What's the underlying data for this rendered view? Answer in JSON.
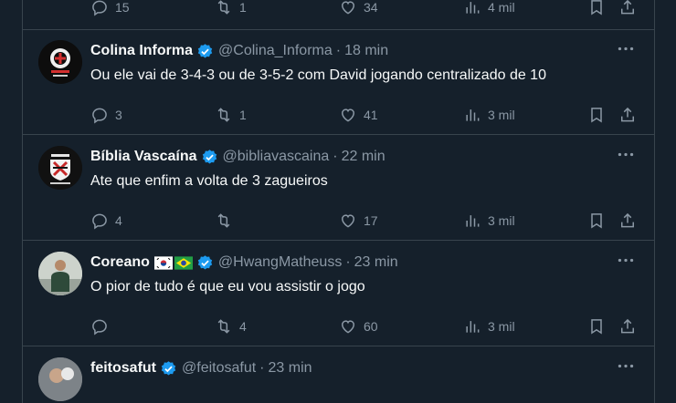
{
  "tweets": [
    {
      "name": "",
      "handle": "",
      "time": "",
      "text": "",
      "replies": "15",
      "retweets": "1",
      "likes": "34",
      "views": "4 mil"
    },
    {
      "name": "Colina Informa",
      "handle": "@Colina_Informa",
      "time": "18 min",
      "text": "Ou ele vai de 3-4-3 ou de 3-5-2 com David jogando centralizado de 10",
      "replies": "3",
      "retweets": "1",
      "likes": "41",
      "views": "3 mil",
      "avatar_color": "#0d0d0d"
    },
    {
      "name": "Bíblia Vascaína",
      "handle": "@bibliavascaina",
      "time": "22 min",
      "text": "Ate que enfim a volta de 3 zagueiros",
      "replies": "4",
      "retweets": "",
      "likes": "17",
      "views": "3 mil",
      "avatar_color": "#111111"
    },
    {
      "name": "Coreano",
      "handle": "@HwangMatheuss",
      "time": "23 min",
      "text": "O pior de tudo é que eu vou assistir o jogo",
      "replies": "",
      "retweets": "4",
      "likes": "60",
      "views": "3 mil",
      "avatar_color": "#c9cfc9"
    },
    {
      "name": "feitosafut",
      "handle": "@feitosafut",
      "time": "23 min",
      "avatar_color": "#8a8f93"
    }
  ],
  "separator": "·",
  "colors": {
    "background": "#15202b",
    "border": "#38444d",
    "muted": "#8b98a5",
    "verified": "#1d9bf0"
  }
}
